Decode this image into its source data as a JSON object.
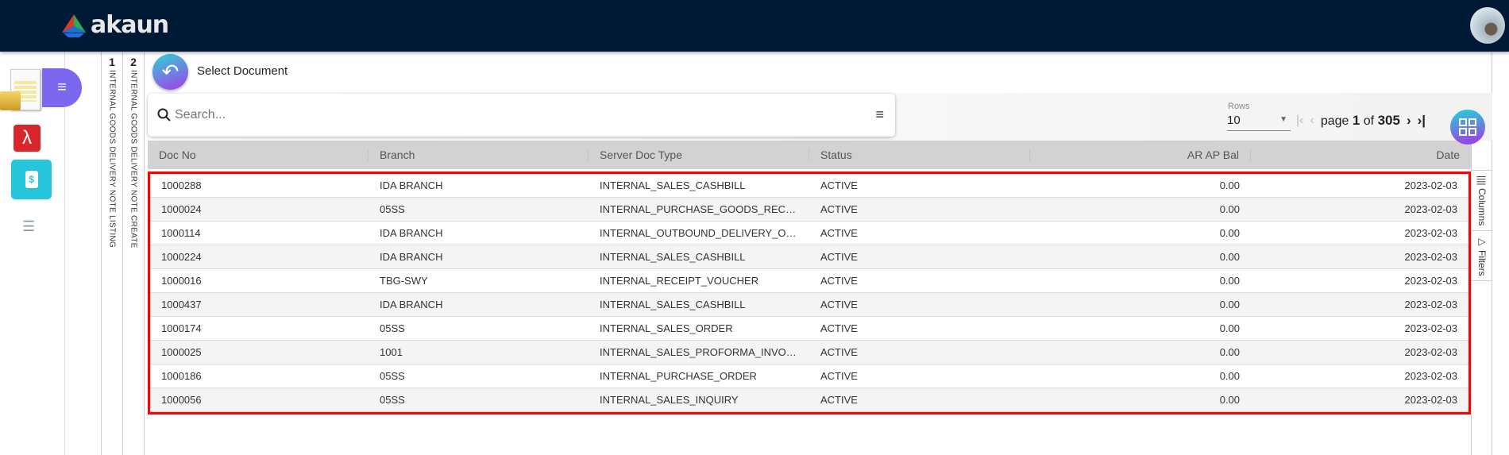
{
  "app": {
    "name": "akaun"
  },
  "vertical_tabs": [
    {
      "num": "1",
      "label": "INTERNAL GOODS DELIVERY NOTE LISTING"
    },
    {
      "num": "2",
      "label": "INTERNAL GOODS DELIVERY NOTE CREATE"
    }
  ],
  "page": {
    "title": "Select Document"
  },
  "search": {
    "placeholder": "Search...",
    "value": ""
  },
  "pagination": {
    "rows_label": "Rows",
    "rows_value": "10",
    "page_label": "page",
    "page": "1",
    "of_label": "of",
    "total_pages": "305"
  },
  "side_panel": {
    "columns": "Columns",
    "filters": "Filters"
  },
  "table": {
    "columns": [
      "Doc No",
      "Branch",
      "Server Doc Type",
      "Status",
      "AR AP Bal",
      "Date"
    ],
    "rows": [
      [
        "1000288",
        "IDA BRANCH",
        "INTERNAL_SALES_CASHBILL",
        "ACTIVE",
        "0.00",
        "2023-02-03"
      ],
      [
        "1000024",
        "05SS",
        "INTERNAL_PURCHASE_GOODS_RECEIVED_NOTE",
        "ACTIVE",
        "0.00",
        "2023-02-03"
      ],
      [
        "1000114",
        "IDA BRANCH",
        "INTERNAL_OUTBOUND_DELIVERY_ORDER",
        "ACTIVE",
        "0.00",
        "2023-02-03"
      ],
      [
        "1000224",
        "IDA BRANCH",
        "INTERNAL_SALES_CASHBILL",
        "ACTIVE",
        "0.00",
        "2023-02-03"
      ],
      [
        "1000016",
        "TBG-SWY",
        "INTERNAL_RECEIPT_VOUCHER",
        "ACTIVE",
        "0.00",
        "2023-02-03"
      ],
      [
        "1000437",
        "IDA BRANCH",
        "INTERNAL_SALES_CASHBILL",
        "ACTIVE",
        "0.00",
        "2023-02-03"
      ],
      [
        "1000174",
        "05SS",
        "INTERNAL_SALES_ORDER",
        "ACTIVE",
        "0.00",
        "2023-02-03"
      ],
      [
        "1000025",
        "1001",
        "INTERNAL_SALES_PROFORMA_INVOICE",
        "ACTIVE",
        "0.00",
        "2023-02-03"
      ],
      [
        "1000186",
        "05SS",
        "INTERNAL_PURCHASE_ORDER",
        "ACTIVE",
        "0.00",
        "2023-02-03"
      ],
      [
        "1000056",
        "05SS",
        "INTERNAL_SALES_INQUIRY",
        "ACTIVE",
        "0.00",
        "2023-02-03"
      ]
    ]
  },
  "colors": {
    "topbar": "#001a35",
    "highlight": "#ff0000",
    "accent_start": "#2ed3d8",
    "accent_end": "#a53bea"
  }
}
